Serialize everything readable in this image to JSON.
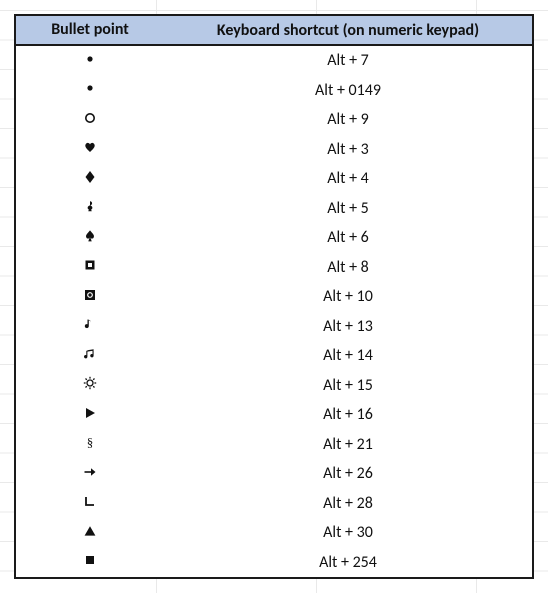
{
  "headers": {
    "symbol": "Bullet point",
    "shortcut": "Keyboard shortcut (on numeric keypad)"
  },
  "rows": [
    {
      "icon": "bullet-dot",
      "shortcut": "Alt + 7"
    },
    {
      "icon": "bullet-dot",
      "shortcut": "Alt + 0149"
    },
    {
      "icon": "circle-outline",
      "shortcut": "Alt + 9"
    },
    {
      "icon": "heart",
      "shortcut": "Alt + 3"
    },
    {
      "icon": "diamond",
      "shortcut": "Alt + 4"
    },
    {
      "icon": "club",
      "shortcut": "Alt + 5"
    },
    {
      "icon": "spade",
      "shortcut": "Alt + 6"
    },
    {
      "icon": "square-inverse",
      "shortcut": "Alt + 8"
    },
    {
      "icon": "square-inverse-circle",
      "shortcut": "Alt + 10"
    },
    {
      "icon": "eighth-note",
      "shortcut": "Alt + 13"
    },
    {
      "icon": "beamed-notes",
      "shortcut": "Alt + 14"
    },
    {
      "icon": "sun-outline",
      "shortcut": "Alt + 15"
    },
    {
      "icon": "play-triangle",
      "shortcut": "Alt + 16"
    },
    {
      "icon": "section-sign",
      "shortcut": "Alt + 21"
    },
    {
      "icon": "arrow-right",
      "shortcut": "Alt + 26"
    },
    {
      "icon": "right-angle",
      "shortcut": "Alt + 28"
    },
    {
      "icon": "triangle-up",
      "shortcut": "Alt + 30"
    },
    {
      "icon": "square-filled",
      "shortcut": "Alt + 254"
    }
  ]
}
